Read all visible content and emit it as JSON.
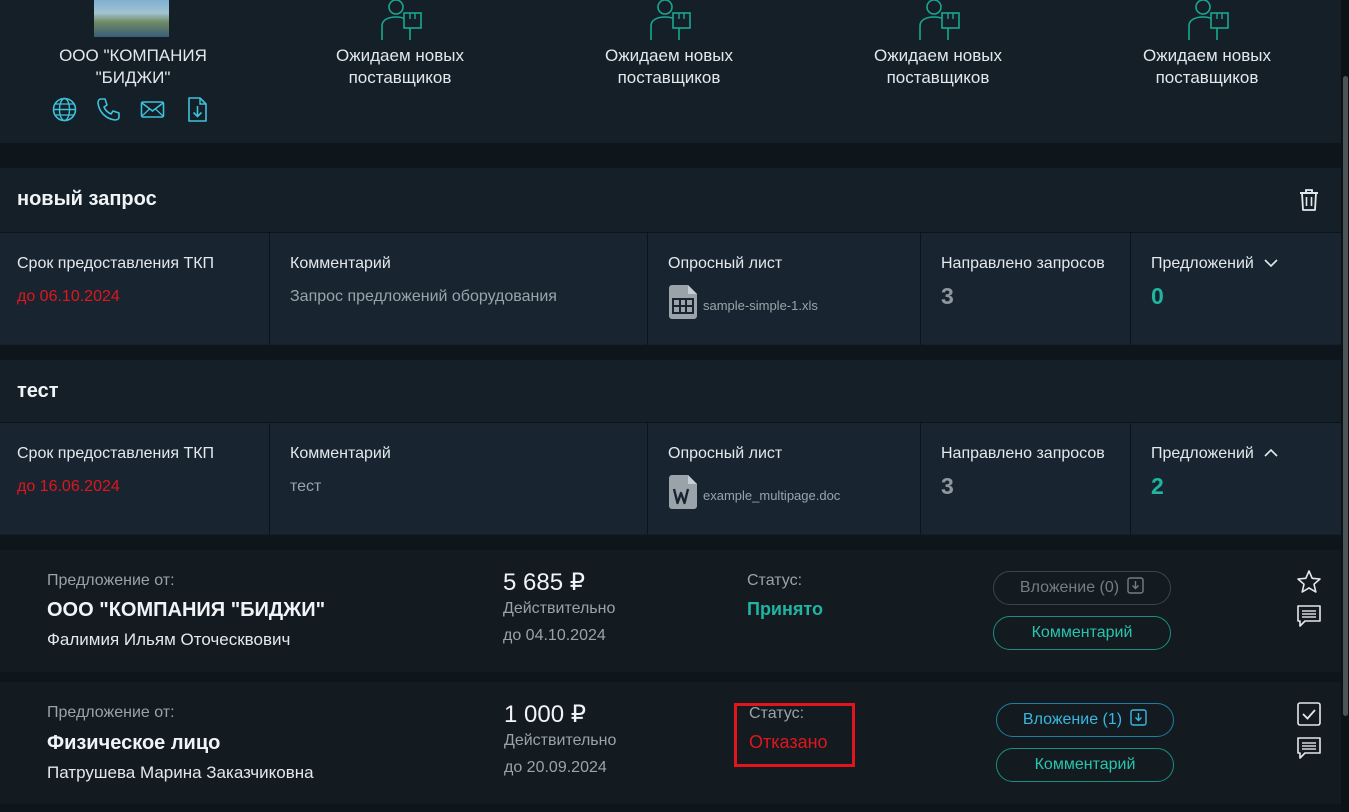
{
  "suppliers": {
    "company": {
      "name_line1": "ООО \"КОМПАНИЯ",
      "name_line2": "\"БИДЖИ\"",
      "photo_icon": "company-photo",
      "icons": [
        "globe-icon",
        "phone-icon",
        "mail-icon",
        "download-file-icon"
      ]
    },
    "waiting": [
      {
        "line1": "Ожидаем новых",
        "line2": "поставщиков"
      },
      {
        "line1": "Ожидаем новых",
        "line2": "поставщиков"
      },
      {
        "line1": "Ожидаем новых",
        "line2": "поставщиков"
      },
      {
        "line1": "Ожидаем новых",
        "line2": "поставщиков"
      }
    ]
  },
  "requests": [
    {
      "title": "новый запрос",
      "deadline_label": "Срок предоставления ТКП",
      "deadline_value": "до 06.10.2024",
      "comment_label": "Комментарий",
      "comment_value": "Запрос предложений оборудования",
      "sheet_label": "Опросный лист",
      "sheet_file": "sample-simple-1.xls",
      "sent_label": "Направлено запросов",
      "sent_value": "3",
      "offers_label": "Предложений",
      "offers_value": "0",
      "offers_expanded": false
    },
    {
      "title": "тест",
      "deadline_label": "Срок предоставления ТКП",
      "deadline_value": "до 16.06.2024",
      "comment_label": "Комментарий",
      "comment_value": "тест",
      "sheet_label": "Опросный лист",
      "sheet_file": "example_multipage.doc",
      "sent_label": "Направлено запросов",
      "sent_value": "3",
      "offers_label": "Предложений",
      "offers_value": "2",
      "offers_expanded": true
    }
  ],
  "proposals": [
    {
      "from_label": "Предложение от:",
      "org": "ООО \"КОМПАНИЯ \"БИДЖИ\"",
      "person": "Фалимия Ильям Оточесквович",
      "price": "5 685 ₽",
      "valid_label": "Действительно",
      "valid_until": "до 04.10.2024",
      "status_label": "Статус:",
      "status_value": "Принято",
      "attachment_label": "Вложение (0)",
      "comment_button": "Комментарий"
    },
    {
      "from_label": "Предложение от:",
      "org": "Физическое лицо",
      "person": "Патрушева Марина Заказчиковна",
      "price": "1 000 ₽",
      "valid_label": "Действительно",
      "valid_until": "до 20.09.2024",
      "status_label": "Статус:",
      "status_value": "Отказано",
      "attachment_label": "Вложение (1)",
      "comment_button": "Комментарий"
    }
  ],
  "colors": {
    "background": "#0e161c",
    "panel": "#141f27",
    "accent_teal": "#1fb5a0",
    "accent_blue": "#39b7e0",
    "danger": "#e0161c"
  }
}
